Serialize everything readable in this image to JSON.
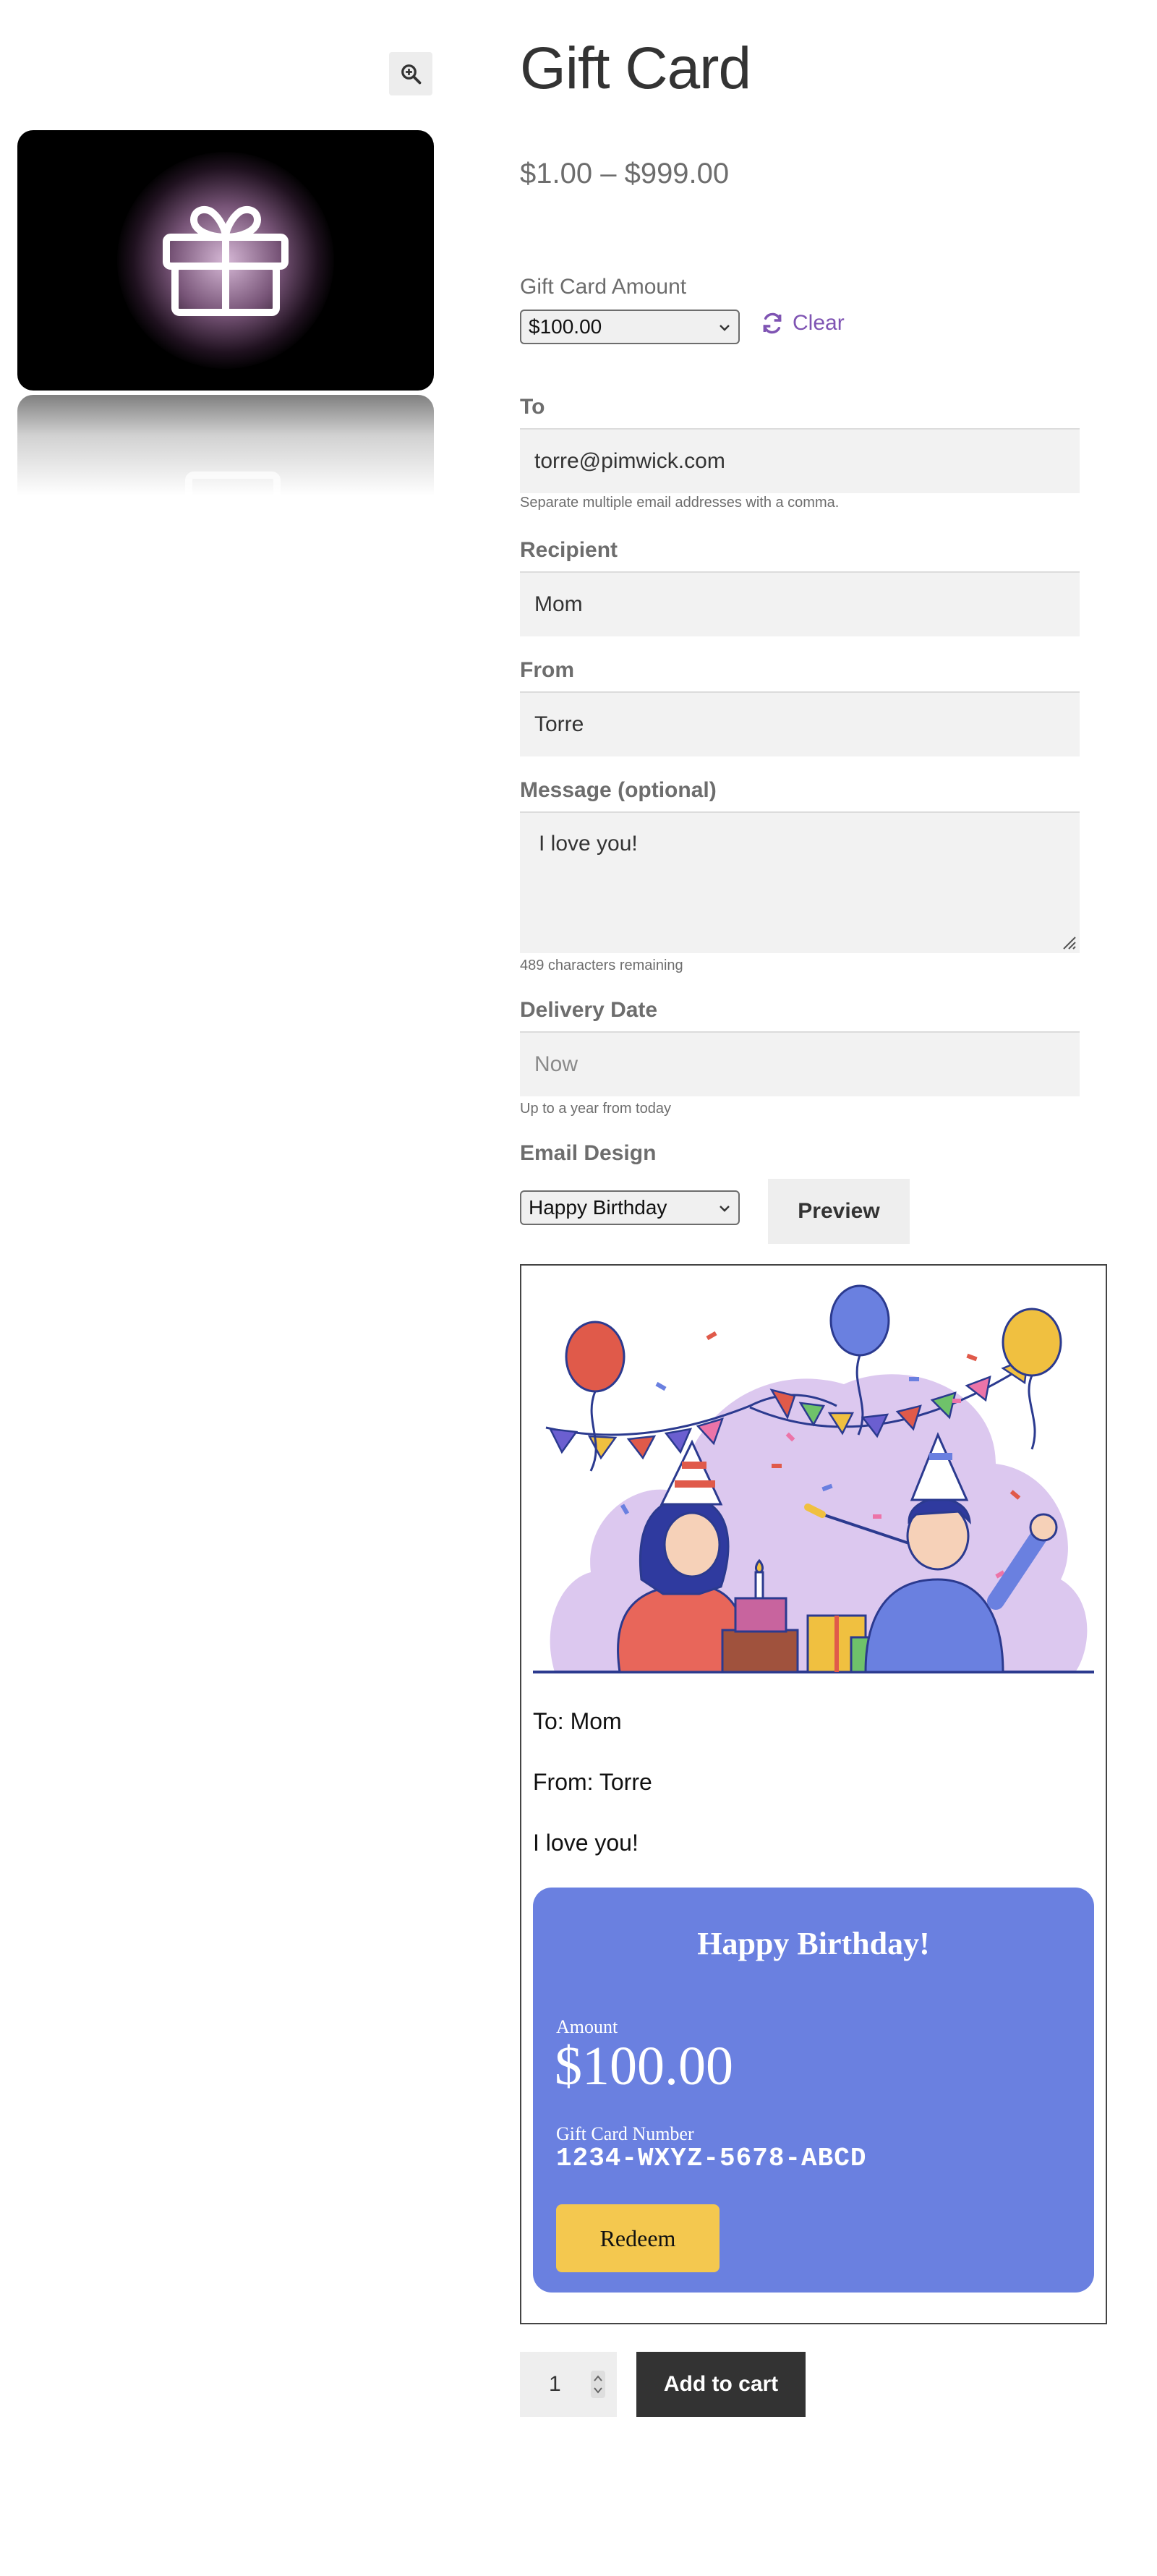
{
  "product": {
    "title": "Gift Card",
    "price_range": "$1.00 – $999.00"
  },
  "amount": {
    "label": "Gift Card Amount",
    "selected": "$100.00",
    "clear_label": "Clear"
  },
  "to": {
    "label": "To",
    "value": "torre@pimwick.com",
    "help": "Separate multiple email addresses with a comma."
  },
  "recipient": {
    "label": "Recipient",
    "value": "Mom"
  },
  "from": {
    "label": "From",
    "value": "Torre"
  },
  "message": {
    "label": "Message (optional)",
    "value": "I love you!",
    "remaining": "489 characters remaining"
  },
  "delivery": {
    "label": "Delivery Date",
    "placeholder": "Now",
    "help": "Up to a year from today"
  },
  "design": {
    "label": "Email Design",
    "selected": "Happy Birthday",
    "preview_label": "Preview"
  },
  "email_preview": {
    "to_line": "To: Mom",
    "from_line": "From: Torre",
    "message_line": "I love you!",
    "card": {
      "heading": "Happy Birthday!",
      "amount_label": "Amount",
      "amount": "$100.00",
      "number_label": "Gift Card Number",
      "number": "1234-WXYZ-5678-ABCD",
      "redeem_label": "Redeem",
      "bg_color": "#6a80e0",
      "button_color": "#f4c84f"
    }
  },
  "cart": {
    "quantity": "1",
    "add_label": "Add to cart"
  },
  "colors": {
    "accent": "#7f54b3",
    "dark_button": "#333333"
  }
}
